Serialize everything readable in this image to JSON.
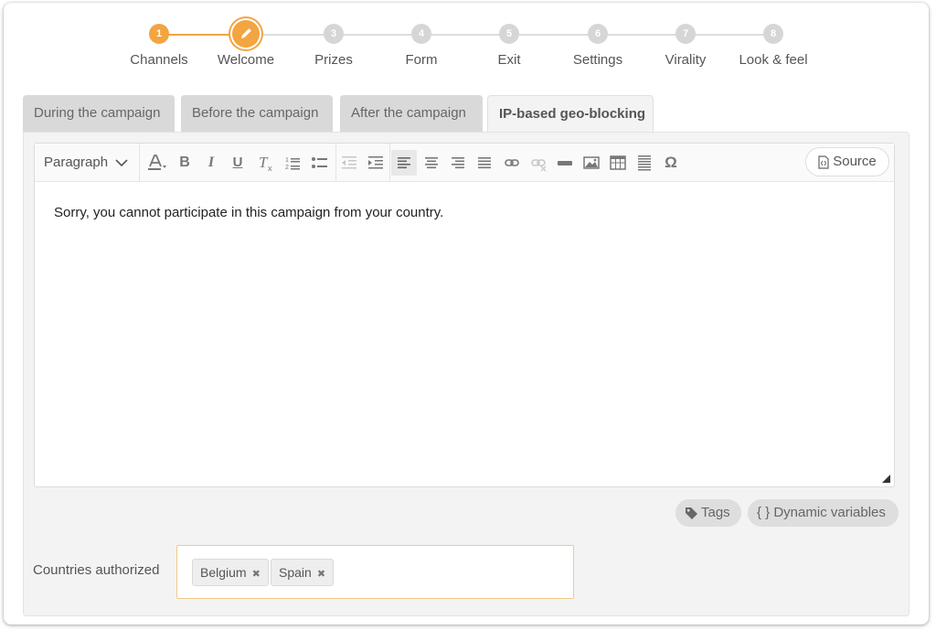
{
  "stepper": {
    "steps": [
      {
        "number": "1",
        "label": "Channels"
      },
      {
        "number": "",
        "label": "Welcome"
      },
      {
        "number": "3",
        "label": "Prizes"
      },
      {
        "number": "4",
        "label": "Form"
      },
      {
        "number": "5",
        "label": "Exit"
      },
      {
        "number": "6",
        "label": "Settings"
      },
      {
        "number": "7",
        "label": "Virality"
      },
      {
        "number": "8",
        "label": "Look & feel"
      }
    ],
    "accent_color": "#f2a541"
  },
  "tabs": [
    {
      "label": "During the campaign"
    },
    {
      "label": "Before the campaign"
    },
    {
      "label": "After the campaign"
    },
    {
      "label": "IP-based geo-blocking"
    }
  ],
  "editor": {
    "toolbar": {
      "paragraph_label": "Paragraph",
      "source_label": "Source",
      "bold": "B",
      "italic": "I",
      "underline": "U",
      "special_char": "Ω"
    },
    "content": "Sorry, you cannot participate in this campaign from your country."
  },
  "actions": {
    "tags_label": "Tags",
    "dynamic_label": "{ } Dynamic variables"
  },
  "countries": {
    "label": "Countries authorized",
    "selected": [
      "Belgium",
      "Spain"
    ]
  }
}
